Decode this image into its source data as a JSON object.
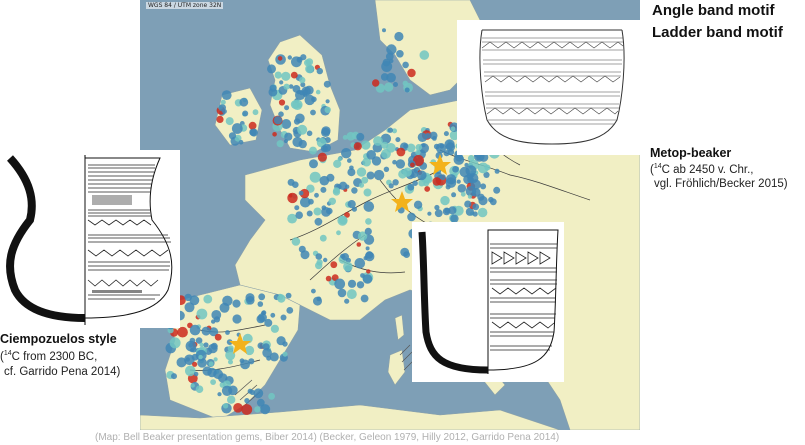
{
  "map": {
    "crs_label": "WGS 84 / UTM zone 32N",
    "colors": {
      "sea": "#7e9fb6",
      "land": "#f1efc4",
      "site_dot": "#3f86b5",
      "site_dot_light": "#71c6c2",
      "hotspot": "#cc2a1e",
      "star": "#f3b21b",
      "river": "#3a3a3a"
    },
    "icons": [
      "star-marker-icon",
      "site-dot-icon",
      "hatched-region-icon"
    ]
  },
  "legend": {
    "angle_band": "Angle band motif",
    "ladder_band": "Ladder band motif"
  },
  "labels": {
    "metop_title": "Metop-beaker",
    "metop_line1_prefix": "(",
    "metop_sup": "14",
    "metop_line1": "C ab 2450 v. Chr.,",
    "metop_line2": "vgl. Fröhlich/Becker 2015)",
    "ciempo_title": "Ciempozuelos style",
    "ciempo_line1_prefix": "(",
    "ciempo_sup": "14",
    "ciempo_line1": "C from 2300 BC,",
    "ciempo_line2": "cf. Garrido Pena 2014)"
  },
  "caption": "(Map: Bell Beaker presentation gems, Biber 2014)   (Becker, Geleon 1979, Hilly 2012, Garrido Pena 2014)"
}
